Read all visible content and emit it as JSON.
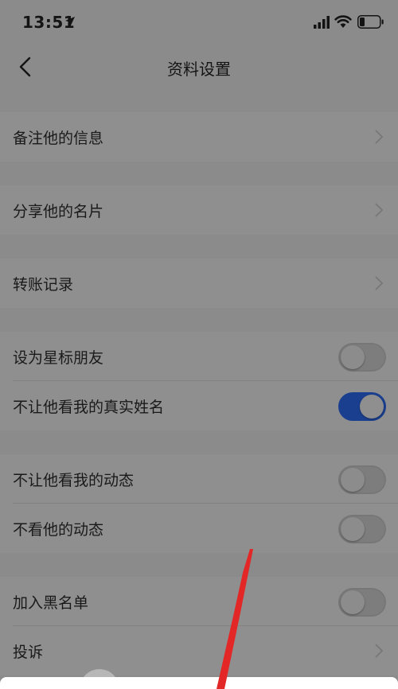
{
  "status_bar": {
    "time": "13:51"
  },
  "nav": {
    "title": "资料设置"
  },
  "rows": {
    "remark": {
      "label": "备注他的信息"
    },
    "share_card": {
      "label": "分享他的名片"
    },
    "transfer_records": {
      "label": "转账记录"
    },
    "star_friend": {
      "label": "设为星标朋友",
      "on": false
    },
    "hide_real_name": {
      "label": "不让他看我的真实姓名",
      "on": true
    },
    "hide_my_moments": {
      "label": "不让他看我的动态",
      "on": false
    },
    "ignore_his_moments": {
      "label": "不看他的动态",
      "on": false
    },
    "blacklist": {
      "label": "加入黑名单",
      "on": false
    },
    "report": {
      "label": "投诉"
    }
  },
  "colors": {
    "toggle_on": "#1b3f8f",
    "annotation_arrow": "#e32626"
  }
}
